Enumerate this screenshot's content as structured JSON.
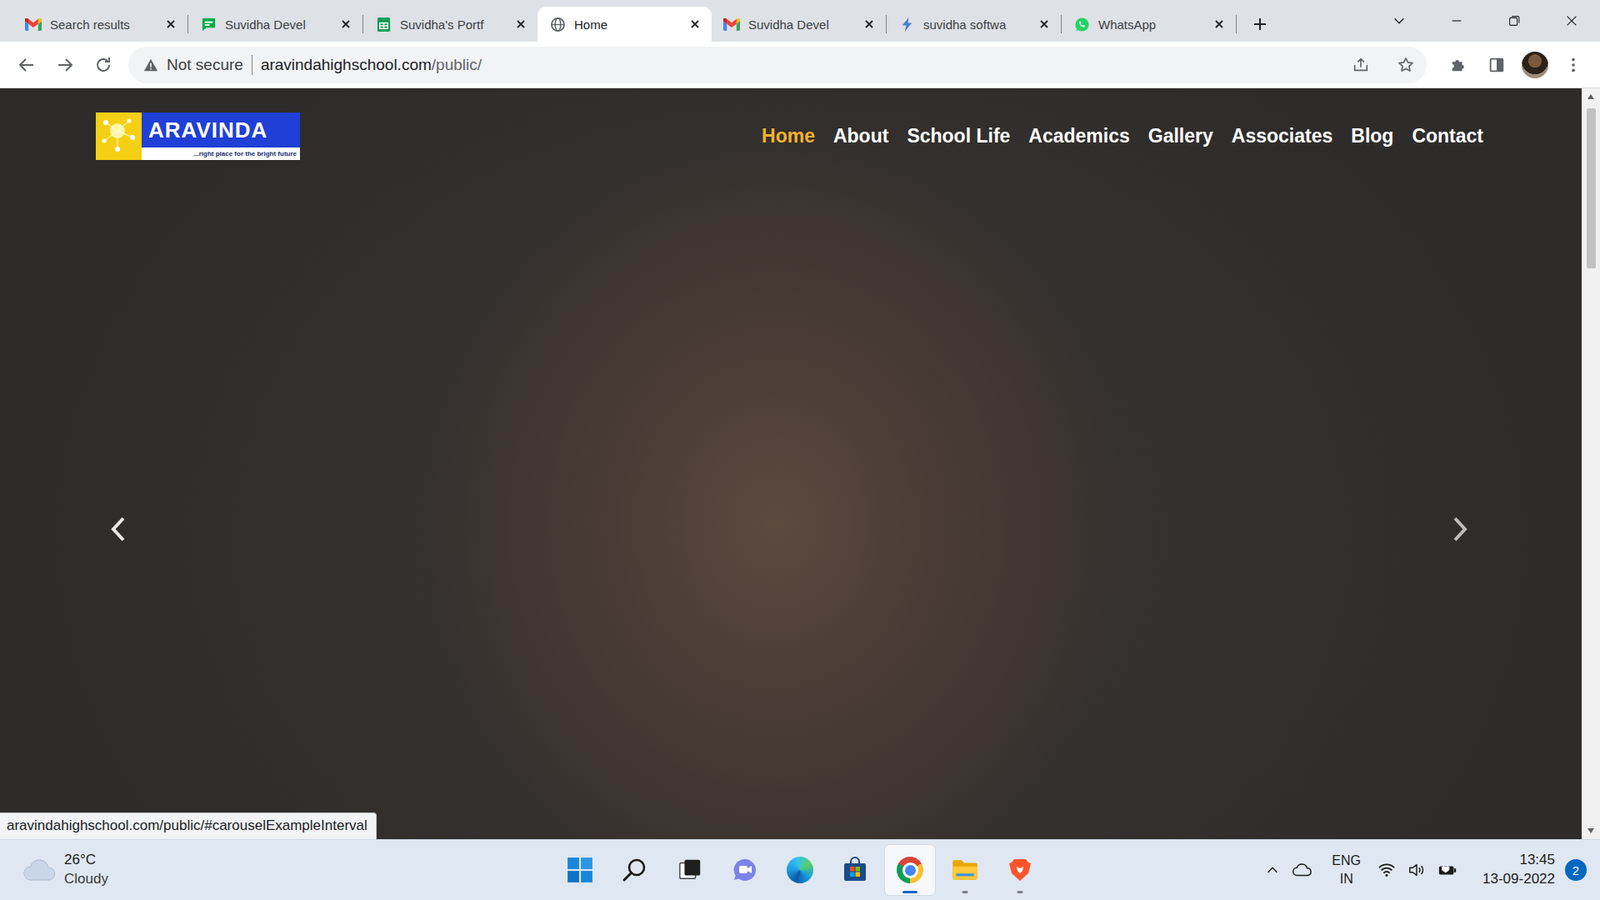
{
  "tabs": [
    {
      "label": "Search results",
      "kind": "gmail",
      "selected": false
    },
    {
      "label": "Suvidha Devel",
      "kind": "chat",
      "selected": false
    },
    {
      "label": "Suvidha's Portf",
      "kind": "sheets",
      "selected": false
    },
    {
      "label": "Home",
      "kind": "globe",
      "selected": true
    },
    {
      "label": "Suvidha Devel",
      "kind": "gmail",
      "selected": false
    },
    {
      "label": "suvidha softwa",
      "kind": "bolt",
      "selected": false
    },
    {
      "label": "WhatsApp",
      "kind": "whatsapp",
      "selected": false
    }
  ],
  "address_bar": {
    "security": "Not secure",
    "host": "aravindahighschool.com",
    "path": "/public/"
  },
  "page": {
    "logo": {
      "name": "ARAVINDA",
      "tagline": "...right place for the bright future"
    },
    "nav": [
      {
        "label": "Home",
        "selected": true
      },
      {
        "label": "About",
        "selected": false
      },
      {
        "label": "School Life",
        "selected": false
      },
      {
        "label": "Academics",
        "selected": false
      },
      {
        "label": "Gallery",
        "selected": false
      },
      {
        "label": "Associates",
        "selected": false
      },
      {
        "label": "Blog",
        "selected": false
      },
      {
        "label": "Contact",
        "selected": false
      }
    ],
    "status_link": "aravindahighschool.com/public/#carouselExampleInterval"
  },
  "taskbar": {
    "weather": {
      "temperature": "26°C",
      "condition": "Cloudy"
    },
    "apps": [
      {
        "kind": "start",
        "running": false,
        "active": false
      },
      {
        "kind": "search",
        "running": false,
        "active": false
      },
      {
        "kind": "task-view",
        "running": false,
        "active": false
      },
      {
        "kind": "chat",
        "running": false,
        "active": false
      },
      {
        "kind": "edge",
        "running": false,
        "active": false
      },
      {
        "kind": "store",
        "running": false,
        "active": false
      },
      {
        "kind": "chrome",
        "running": true,
        "active": true
      },
      {
        "kind": "explorer",
        "running": true,
        "active": false
      },
      {
        "kind": "brave",
        "running": true,
        "active": false
      }
    ],
    "tray": {
      "language": "ENG",
      "region": "IN",
      "time": "13:45",
      "date": "13-09-2022",
      "notifications": "2"
    }
  }
}
